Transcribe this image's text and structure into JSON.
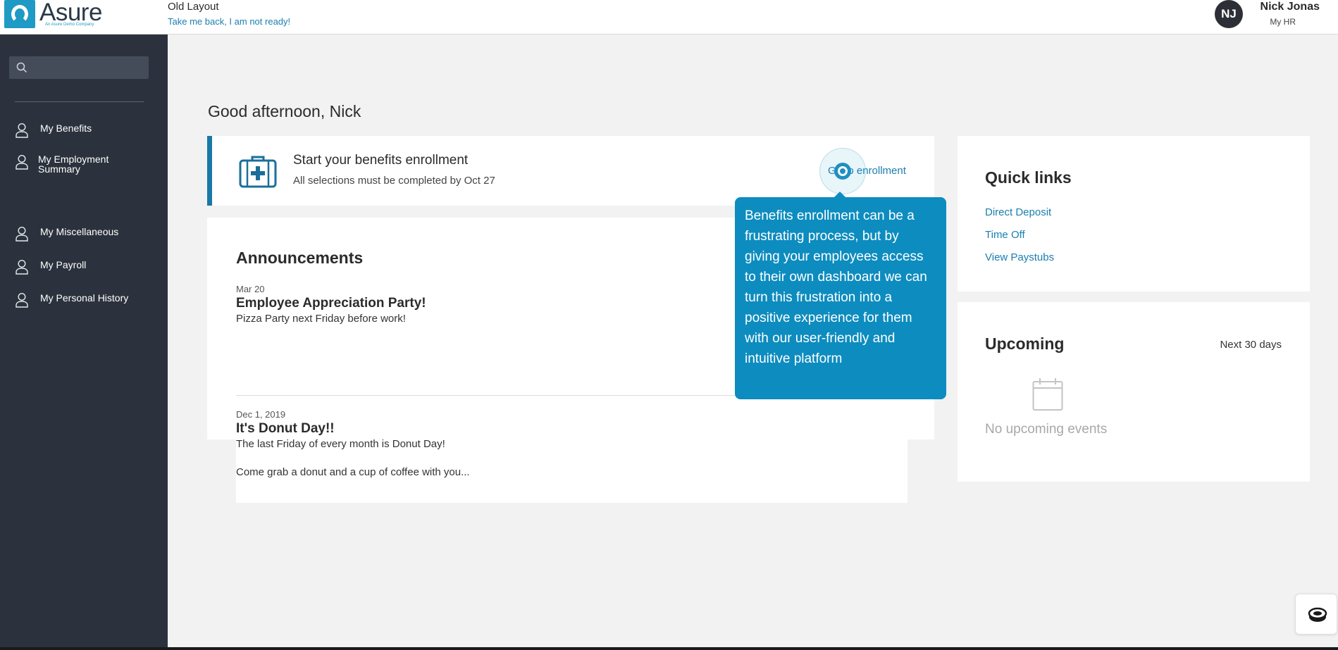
{
  "header": {
    "logo_text": "Asure",
    "logo_subtitle": "An Asure Demo Company",
    "old_layout_label": "Old Layout",
    "take_back_link": "Take me back, I am not ready!",
    "user": {
      "initials": "NJ",
      "name": "Nick Jonas",
      "role": "My HR"
    }
  },
  "sidebar": {
    "search": {
      "value": "",
      "placeholder": "",
      "icon": "search-icon"
    },
    "items": [
      {
        "label": "My Benefits",
        "icon": "person-icon"
      },
      {
        "label": "My Employment Summary",
        "icon": "person-icon"
      },
      {
        "label": "My Miscellaneous",
        "icon": "person-icon"
      },
      {
        "label": "My Payroll",
        "icon": "person-icon"
      },
      {
        "label": "My Personal History",
        "icon": "person-icon"
      }
    ]
  },
  "main": {
    "greeting": "Good afternoon, Nick",
    "enrollment": {
      "title": "Start your benefits enrollment",
      "subtitle": "All selections must be completed by Oct 27",
      "action_label": "Go to enrollment",
      "icon": "medical-kit-icon"
    },
    "tooltip_text": "Benefits enrollment can be a frustrating process, but by giving your employees access to their own dashboard we can turn this frustration into a positive experience for them with our user-friendly and intuitive platform",
    "announcements": {
      "title": "Announcements",
      "items": [
        {
          "date": "Mar 20",
          "title": "Employee Appreciation Party!",
          "body": "Pizza Party next Friday before work!"
        },
        {
          "date": "Dec 1, 2019",
          "title": "It's Donut Day!!",
          "body": "The last Friday of every month is Donut Day!",
          "body2": "Come grab a donut and a cup of coffee with you..."
        }
      ]
    }
  },
  "quick_links": {
    "title": "Quick links",
    "links": [
      "Direct Deposit",
      "Time Off",
      "View Paystubs"
    ]
  },
  "upcoming": {
    "title": "Upcoming",
    "range": "Next 30 days",
    "empty_text": "No upcoming events",
    "icon": "calendar-icon"
  },
  "colors": {
    "sidebar_bg": "#2c323d",
    "accent": "#1a7fb0",
    "tooltip_bg": "#0d8cbf",
    "enroll_border": "#1a78a6"
  }
}
